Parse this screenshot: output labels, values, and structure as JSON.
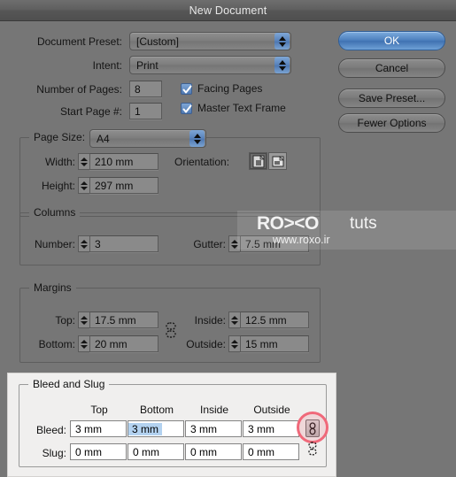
{
  "window": {
    "title": "New Document"
  },
  "preset_row": {
    "label": "Document Preset:",
    "value": "[Custom]"
  },
  "intent_row": {
    "label": "Intent:",
    "value": "Print"
  },
  "pages": {
    "number_label": "Number of Pages:",
    "number_value": "8",
    "start_label": "Start Page #:",
    "start_value": "1"
  },
  "checkboxes": [
    {
      "label": "Facing Pages",
      "checked": true
    },
    {
      "label": "Master Text Frame",
      "checked": true
    }
  ],
  "buttons": {
    "ok": "OK",
    "cancel": "Cancel",
    "save_preset": "Save Preset...",
    "fewer_options": "Fewer Options"
  },
  "page_size": {
    "group_label": "Page Size:",
    "value": "A4",
    "width_label": "Width:",
    "width_value": "210 mm",
    "height_label": "Height:",
    "height_value": "297 mm",
    "orientation_label": "Orientation:",
    "orientation_portrait_icon": "portrait-page-icon",
    "orientation_landscape_icon": "landscape-page-icon",
    "orientation_selected": "portrait"
  },
  "columns": {
    "group_label": "Columns",
    "number_label": "Number:",
    "number_value": "3",
    "gutter_label": "Gutter:",
    "gutter_value": "7.5 mm"
  },
  "margins": {
    "group_label": "Margins",
    "top_label": "Top:",
    "top_value": "17.5 mm",
    "bottom_label": "Bottom:",
    "bottom_value": "20 mm",
    "inside_label": "Inside:",
    "inside_value": "12.5 mm",
    "outside_label": "Outside:",
    "outside_value": "15 mm",
    "link_icon": "broken-chain-link-icon"
  },
  "bleed_slug": {
    "group_label": "Bleed and Slug",
    "columns": [
      "Top",
      "Bottom",
      "Inside",
      "Outside"
    ],
    "rows": [
      {
        "label": "Bleed:",
        "values": [
          "3 mm",
          "3 mm",
          "3 mm",
          "3 mm"
        ],
        "selected_index": 1,
        "link_icon": "chain-link-icon",
        "link_highlighted": true
      },
      {
        "label": "Slug:",
        "values": [
          "0 mm",
          "0 mm",
          "0 mm",
          "0 mm"
        ],
        "selected_index": -1,
        "link_icon": "broken-chain-link-icon",
        "link_highlighted": false
      }
    ]
  },
  "watermark": {
    "brand_left": "RO",
    "brand_mid": "><",
    "brand_right": "O",
    "brand_suffix": "tuts",
    "url": "www.roxo.ir"
  },
  "colors": {
    "window_bg": "#767676",
    "accent_blue": "#4f79b2",
    "highlight_red": "#f0697a",
    "field_selection": "#b3d2f0",
    "light_panel": "#f0efee"
  }
}
